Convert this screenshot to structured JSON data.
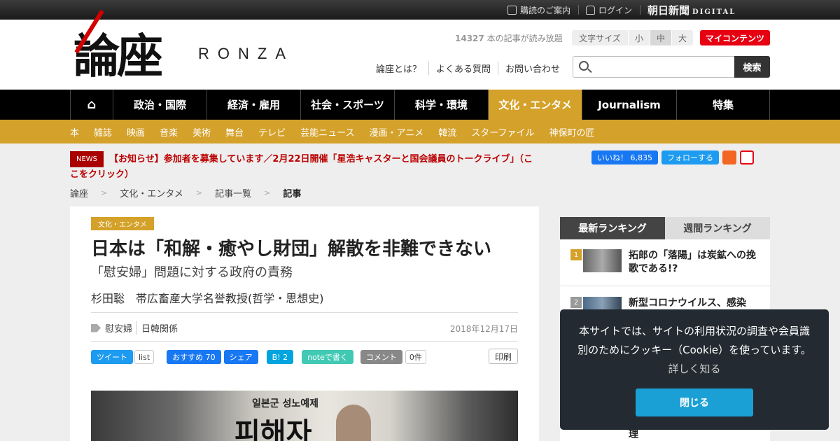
{
  "topbar": {
    "subscribe": "購読のご案内",
    "login": "ログイン",
    "brand": "朝日新聞",
    "brand_sub": "DIGITAL"
  },
  "header": {
    "logo_kanji": "論座",
    "logo_roman": "RONZA",
    "article_count": "14327",
    "article_count_suffix": " 本の記事が読み放題",
    "fontsize_label": "文字サイズ",
    "fontsize_options": [
      "小",
      "中",
      "大"
    ],
    "fontsize_selected": "中",
    "my_contents": "マイコンテンツ",
    "links": [
      "論座とは？",
      "よくある質問",
      "お問い合わせ"
    ],
    "search_placeholder": "",
    "search_button": "検索"
  },
  "nav": {
    "home_icon": "home-icon",
    "items": [
      "政治・国際",
      "経済・雇用",
      "社会・スポーツ",
      "科学・環境",
      "文化・エンタメ",
      "Journalism",
      "特集"
    ],
    "active": "文化・エンタメ"
  },
  "subnav": [
    "本",
    "雑誌",
    "映画",
    "音楽",
    "美術",
    "舞台",
    "テレビ",
    "芸能ニュース",
    "漫画・アニメ",
    "韓流",
    "スターファイル",
    "神保町の匠"
  ],
  "news": {
    "badge": "NEWS",
    "text": "【お知らせ】参加者を募集しています／2月22日開催「星浩キャスターと国会議員のトークライブ」（ここをクリック）"
  },
  "social": {
    "fb": "いいね！ 6,835",
    "tw": "フォローする"
  },
  "breadcrumb": [
    "論座",
    "文化・エンタメ",
    "記事一覧",
    "記事"
  ],
  "article": {
    "category": "文化・エンタメ",
    "title": "日本は「和解・癒やし財団」解散を非難できない",
    "subtitle": "「慰安婦」問題に対する政府の責務",
    "author": "杉田聡　帯広畜産大学名誉教授(哲学・思想史)",
    "tags": [
      "慰安婦",
      "日韓関係"
    ],
    "date": "2018年12月17日",
    "share": {
      "tweet": "ツイート",
      "list": "list",
      "fb_recommend": "おすすめ 70",
      "fb_share": "シェア",
      "hatena": "B! 2",
      "note": "noteで書く",
      "comment": "コメント",
      "comment_count": "0件",
      "print": "印刷"
    },
    "photo_text_1": "일본군 성노예제",
    "photo_text_2": "피해자"
  },
  "ranking": {
    "tabs": [
      "最新ランキング",
      "週間ランキング"
    ],
    "active_tab": "最新ランキング",
    "items": [
      {
        "rank": "1",
        "title": "拓郎の「落陽」は炭鉱への挽歌である!?"
      },
      {
        "rank": "2",
        "title": "新型コロナウイルス、感染"
      }
    ],
    "tail_text": "理"
  },
  "cookie": {
    "message": "本サイトでは、サイトの利用状況の調査や会員識別のためにクッキー（Cookie）を使っています。",
    "more": "詳しく知る",
    "close": "閉じる"
  },
  "colors": {
    "accent": "#d4a12a",
    "red": "#e60012",
    "nav_bg": "#000000",
    "cookie_bg": "#232a31",
    "cookie_button": "#1aa0d4"
  }
}
